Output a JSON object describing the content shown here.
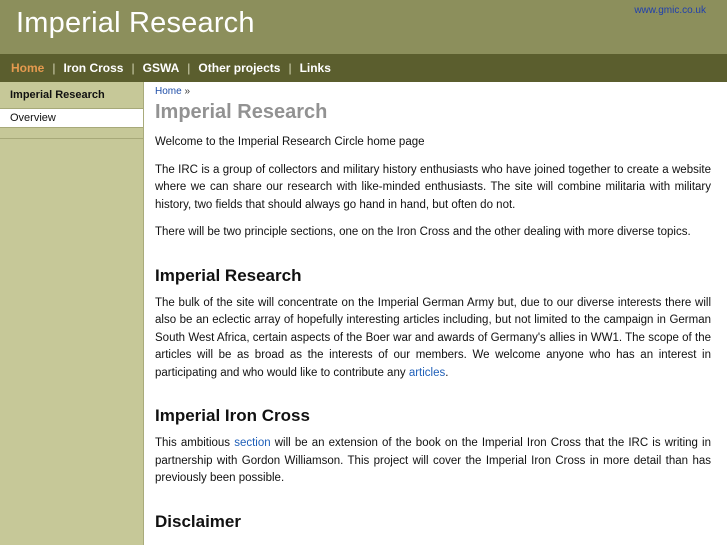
{
  "header": {
    "title": "Imperial Research",
    "link": "www.gmic.co.uk"
  },
  "nav": {
    "items": [
      "Home",
      "Iron Cross",
      "GSWA",
      "Other projects",
      "Links"
    ],
    "separator": "|"
  },
  "sidebar": {
    "heading": "Imperial Research",
    "items": [
      "Overview"
    ]
  },
  "breadcrumb": {
    "home": "Home",
    "sep": "»"
  },
  "content": {
    "title": "Imperial Research",
    "intro": "Welcome to the Imperial Research Circle home page",
    "p1": "The IRC is a group of collectors and military history enthusiasts who have joined together to create a website where we can share our research with like-minded enthusiasts. The site will combine militaria with military history, two fields that should always go hand in hand, but often do not.",
    "p2": "There will be two principle sections, one on the Iron Cross and the other dealing with more diverse topics.",
    "section1": {
      "heading": "Imperial Research",
      "text": "The bulk of the site will concentrate on the Imperial German Army but, due to our diverse interests there will also be an eclectic array of hopefully interesting articles including, but not limited to the campaign in German South West Africa, certain aspects of the Boer war and awards of Germany's allies in WW1. The scope of the articles will be as broad as the interests of our members. We welcome anyone who has an interest in participating and who would like to contribute any",
      "link": "articles",
      "end": "."
    },
    "section2": {
      "heading": "Imperial Iron Cross",
      "text_before": "This ambitious",
      "link": "section",
      "text_after": "will be an extension of the book on the Imperial Iron Cross that the IRC is writing in partnership with Gordon Williamson. This project will cover the Imperial Iron Cross in more detail than has previously been possible."
    },
    "section3": {
      "heading": "Disclaimer"
    }
  }
}
